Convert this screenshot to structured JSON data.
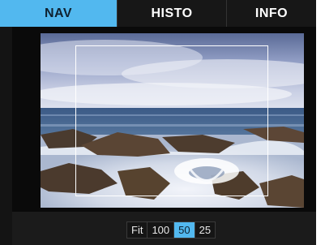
{
  "tabs": [
    {
      "label": "NAV",
      "active": true
    },
    {
      "label": "HISTO",
      "active": false
    },
    {
      "label": "INFO",
      "active": false
    }
  ],
  "zoom": {
    "options": [
      "Fit",
      "100",
      "50",
      "25"
    ],
    "selected": "50"
  },
  "colors": {
    "accent": "#52b8ef",
    "panel_bg": "#141414"
  }
}
